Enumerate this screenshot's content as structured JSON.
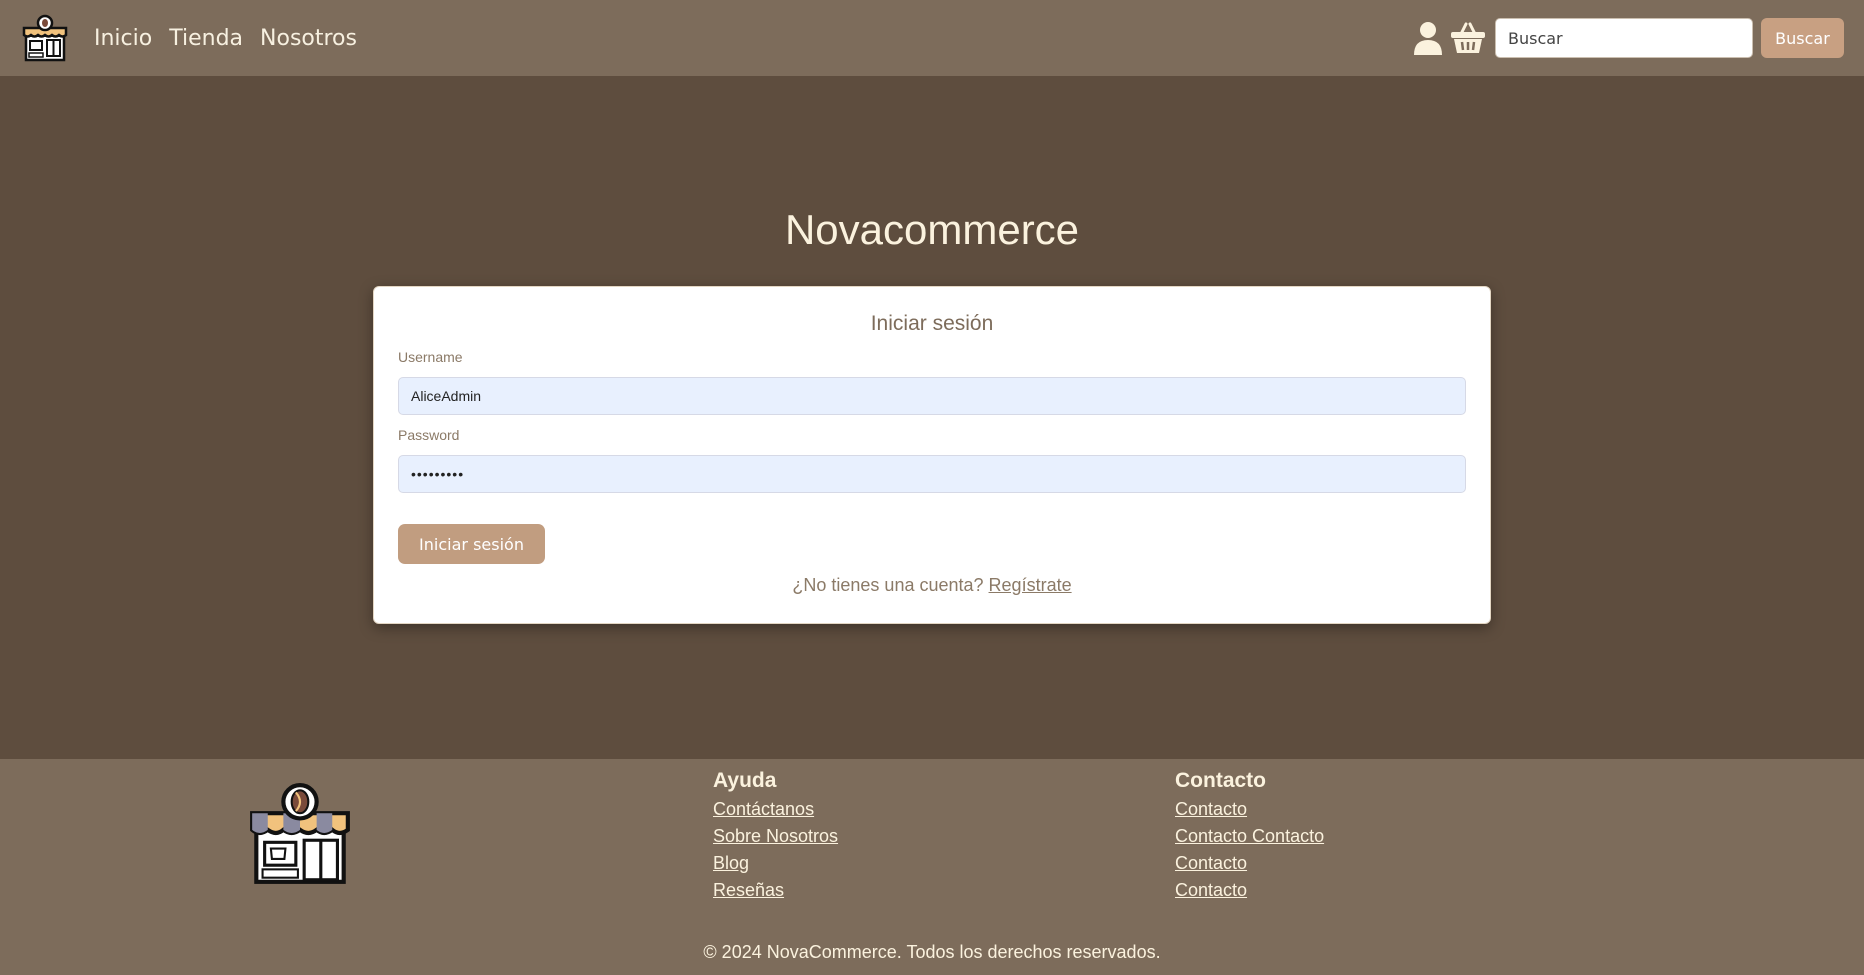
{
  "nav": {
    "links": [
      "Inicio",
      "Tienda",
      "Nosotros"
    ],
    "search_placeholder": "Buscar",
    "search_button": "Buscar"
  },
  "main": {
    "title": "Novacommerce",
    "card_title": "Iniciar sesión",
    "username_label": "Username",
    "username_value": "AliceAdmin",
    "password_label": "Password",
    "password_value": "•••••••••",
    "submit_label": "Iniciar sesión",
    "register_prompt": "¿No tienes una cuenta?",
    "register_link": "Regístrate"
  },
  "footer": {
    "help_heading": "Ayuda",
    "help_links": [
      "Contáctanos",
      "Sobre Nosotros",
      "Blog",
      "Reseñas"
    ],
    "contact_heading": "Contacto",
    "contact_links": [
      "Contacto",
      "Contacto Contacto",
      "Contacto",
      "Contacto"
    ],
    "copyright": "© 2024 NovaCommerce. Todos los derechos reservados."
  },
  "colors": {
    "navbar": "#7d6c5b",
    "background": "#5e4d3e",
    "accent_button": "#c19d80",
    "input_fill": "#e8f0fe"
  },
  "icons": [
    "coffee-shop-logo-icon",
    "user-icon",
    "basket-icon"
  ]
}
